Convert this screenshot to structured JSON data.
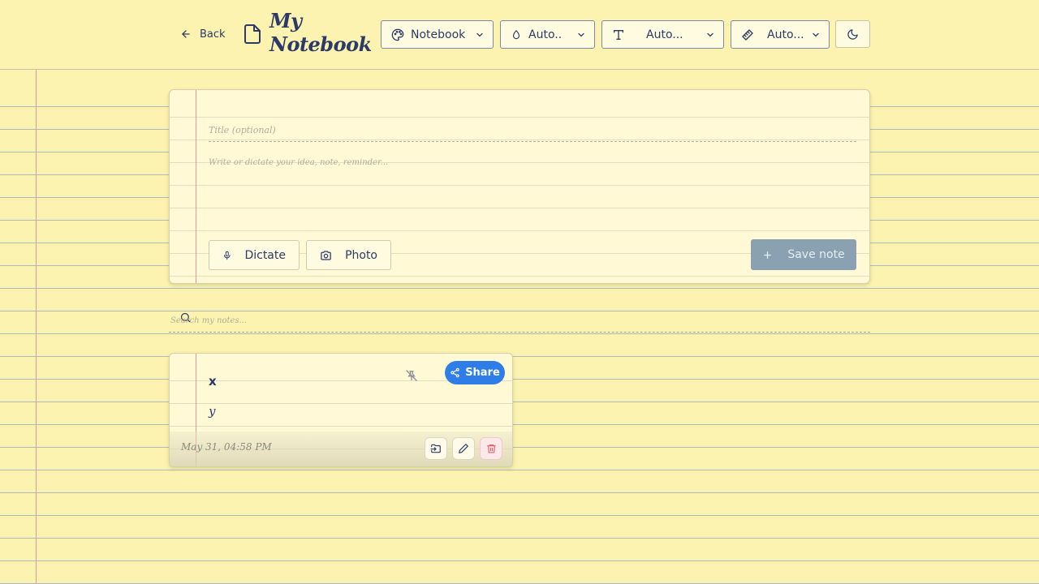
{
  "header": {
    "back_label": "Back",
    "title": "My Notebook",
    "dropdowns": [
      {
        "icon": "palette-icon",
        "label": "Notebook"
      },
      {
        "icon": "droplet-icon",
        "label": "Auto.."
      },
      {
        "icon": "type-icon",
        "label": "Auto..."
      },
      {
        "icon": "ruler-icon",
        "label": "Auto..."
      }
    ],
    "theme_icon": "moon-icon"
  },
  "composer": {
    "title_placeholder": "Title (optional)",
    "title_value": "",
    "body_placeholder": "Write or dictate your idea, note, reminder...",
    "body_value": "",
    "dictate_label": "Dictate",
    "photo_label": "Photo",
    "save_label": "Save note"
  },
  "search": {
    "placeholder": "Search my notes...",
    "value": ""
  },
  "notes": [
    {
      "title": "x",
      "body": "y",
      "date": "May 31, 04:58 PM",
      "share_label": "Share"
    }
  ],
  "colors": {
    "paper": "#fdf3b0",
    "ink": "#2b3a67",
    "margin": "#e59a9a",
    "accent": "#2f7ee8",
    "save_disabled": "#8aa1b2",
    "delete": "#e25563"
  }
}
